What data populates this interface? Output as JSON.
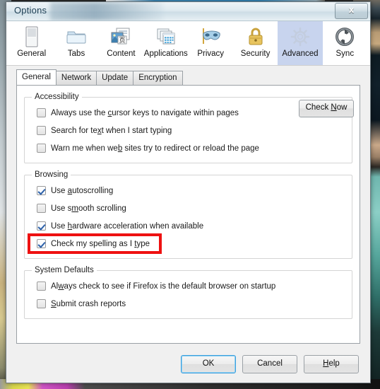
{
  "window": {
    "title": "Options",
    "close_label": "x",
    "close_icon": "close-icon"
  },
  "categories": [
    {
      "label": "General",
      "icon": "general-window-icon",
      "selected": false
    },
    {
      "label": "Tabs",
      "icon": "folder-tabs-icon",
      "selected": false
    },
    {
      "label": "Content",
      "icon": "content-page-icon",
      "selected": false
    },
    {
      "label": "Applications",
      "icon": "applications-icon",
      "selected": false
    },
    {
      "label": "Privacy",
      "icon": "privacy-mask-icon",
      "selected": false
    },
    {
      "label": "Security",
      "icon": "security-lock-icon",
      "selected": false
    },
    {
      "label": "Advanced",
      "icon": "advanced-gear-icon",
      "selected": true
    },
    {
      "label": "Sync",
      "icon": "sync-arrows-icon",
      "selected": false
    }
  ],
  "subtabs": [
    {
      "label": "General",
      "active": true
    },
    {
      "label": "Network",
      "active": false
    },
    {
      "label": "Update",
      "active": false
    },
    {
      "label": "Encryption",
      "active": false
    }
  ],
  "groups": {
    "accessibility": {
      "legend": "Accessibility",
      "items": [
        {
          "pre": "Always use the ",
          "key": "c",
          "post": "ursor keys to navigate within pages",
          "checked": false
        },
        {
          "pre": "Search for te",
          "key": "x",
          "post": "t when I start typing",
          "checked": false
        },
        {
          "pre": "Warn me when we",
          "key": "b",
          "post": " sites try to redirect or reload the page",
          "checked": false
        }
      ]
    },
    "browsing": {
      "legend": "Browsing",
      "items": [
        {
          "pre": "Use ",
          "key": "a",
          "post": "utoscrolling",
          "checked": true,
          "highlighted": false
        },
        {
          "pre": "Use s",
          "key": "m",
          "post": "ooth scrolling",
          "checked": false,
          "highlighted": false
        },
        {
          "pre": "Use ",
          "key": "h",
          "post": "ardware acceleration when available",
          "checked": true,
          "highlighted": false
        },
        {
          "pre": "Check my spelling as I ",
          "key": "t",
          "post": "ype",
          "checked": true,
          "highlighted": true
        }
      ]
    },
    "system_defaults": {
      "legend": "System Defaults",
      "items": [
        {
          "pre": "Al",
          "key": "w",
          "post": "ays check to see if Firefox is the default browser on startup",
          "checked": false
        },
        {
          "pre": "",
          "key": "S",
          "post": "ubmit crash reports",
          "checked": false
        }
      ],
      "check_now": {
        "pre": "Check ",
        "key": "N",
        "post": "ow"
      }
    }
  },
  "buttons": {
    "ok": {
      "pre": "OK",
      "key": "",
      "post": "",
      "focused": true
    },
    "cancel": {
      "pre": "Cancel",
      "key": "",
      "post": "",
      "focused": false
    },
    "help": {
      "pre": "",
      "key": "H",
      "post": "elp",
      "focused": false
    }
  },
  "colors": {
    "annotation": "#ee1111",
    "selected_tab": "#c8d4ee",
    "focus_border": "#3c9fdd"
  }
}
